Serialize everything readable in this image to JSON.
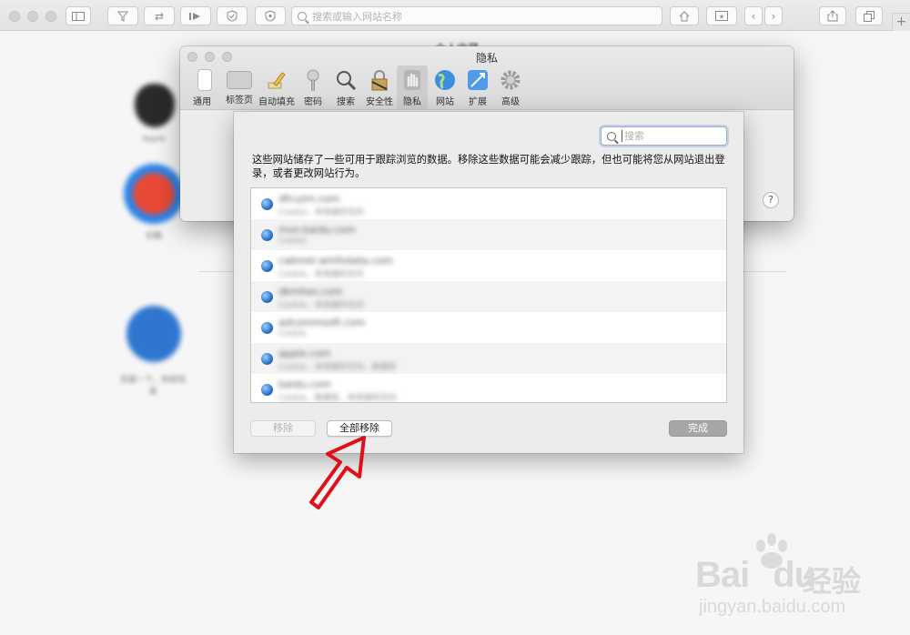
{
  "safari": {
    "address_placeholder": "搜索或输入网站名称",
    "new_tab_label": "+"
  },
  "background": {
    "favorites_title": "个人收藏",
    "favorites": [
      {
        "caption": "Apple"
      },
      {
        "caption": "优酷"
      },
      {
        "caption": "百度一下，你就知道"
      }
    ]
  },
  "preferences": {
    "title": "隐私",
    "tabs": [
      {
        "label": "通用",
        "icon": "general-icon"
      },
      {
        "label": "标签页",
        "icon": "tabs-icon"
      },
      {
        "label": "自动填充",
        "icon": "autofill-pencil-icon"
      },
      {
        "label": "密码",
        "icon": "passwords-key-icon"
      },
      {
        "label": "搜索",
        "icon": "search-icon"
      },
      {
        "label": "安全性",
        "icon": "security-lock-icon"
      },
      {
        "label": "隐私",
        "icon": "privacy-hand-icon",
        "active": true
      },
      {
        "label": "网站",
        "icon": "websites-globe-icon"
      },
      {
        "label": "扩展",
        "icon": "extensions-icon"
      },
      {
        "label": "高级",
        "icon": "advanced-gear-icon"
      }
    ],
    "help_label": "?"
  },
  "website_data_sheet": {
    "search_placeholder": "搜索",
    "description": "这些网站储存了一些可用于跟踪浏览的数据。移除这些数据可能会减少跟踪，但也可能将您从网站退出登录，或者更改网站行为。",
    "sites": [
      {
        "name": "dfcuzm.com",
        "meta": "Cookie，本地储存空间"
      },
      {
        "name": "msn.baidu.com",
        "meta": "Cookie"
      },
      {
        "name": "cabinet.winfodata.com",
        "meta": "Cookie，本地储存空间"
      },
      {
        "name": "dkmhes.com",
        "meta": "Cookie，本地储存空间"
      },
      {
        "name": "adcommsoft.com",
        "meta": "Cookie"
      },
      {
        "name": "apple.com",
        "meta": "Cookie，本地储存空间，数据库"
      },
      {
        "name": "baidu.com",
        "meta": "Cookie，数据库，本地储存空间"
      }
    ],
    "remove_label": "移除",
    "remove_all_label": "全部移除",
    "done_label": "完成"
  },
  "watermark": {
    "brand": "Bai",
    "brand_du": "du",
    "cn": "经验",
    "url": "jingyan.baidu.com"
  },
  "colors": {
    "arrow": "#e0101a",
    "globe": "#2a72c9"
  }
}
